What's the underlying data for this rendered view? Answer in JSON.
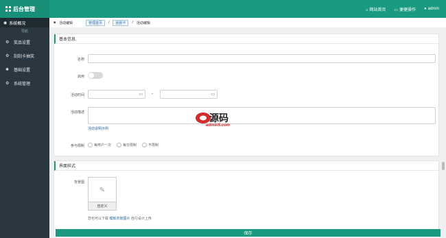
{
  "header": {
    "brand": "后台管理",
    "nav": [
      {
        "icon": "home-icon",
        "glyph": "⌂",
        "label": "网站首页"
      },
      {
        "icon": "screen-icon",
        "glyph": "▭",
        "label": "便捷操作"
      },
      {
        "icon": "user-icon",
        "glyph": "●",
        "label": "admin"
      }
    ]
  },
  "sidebar": {
    "overview": "系统概况",
    "subtitle": "导航",
    "items": [
      {
        "icon": "settings-icon",
        "label": "奖品设置"
      },
      {
        "icon": "settings-icon",
        "label": "刮刮卡抽奖"
      },
      {
        "icon": "gear-icon",
        "label": "基础设置"
      },
      {
        "icon": "gears-icon",
        "label": "系统管理"
      }
    ]
  },
  "breadcrumb": {
    "current_section": "活动编辑",
    "links": [
      "管理首页",
      "刮刮卡"
    ],
    "sep": "/",
    "current": "活动编辑"
  },
  "basic_panel": {
    "title": "基本信息",
    "name_label": "名称",
    "enable_label": "启用",
    "time_label": "活动时间",
    "time_sep": "-",
    "desc_label": "活动描述",
    "desc_example": "活动说明示例",
    "limit_label": "参与限制",
    "limit_options": [
      "每用户一次",
      "每日限制",
      "不限制"
    ]
  },
  "style_panel": {
    "title": "界面样式",
    "bg_label": "背景图",
    "img_caption": "自定义",
    "hint_prefix": "您也可以下载",
    "hint_link": "模板背景图片",
    "hint_suffix": "自行设计上传"
  },
  "save_button": "保存",
  "watermark": {
    "brand": "源码",
    "domain": "admin5.com"
  }
}
